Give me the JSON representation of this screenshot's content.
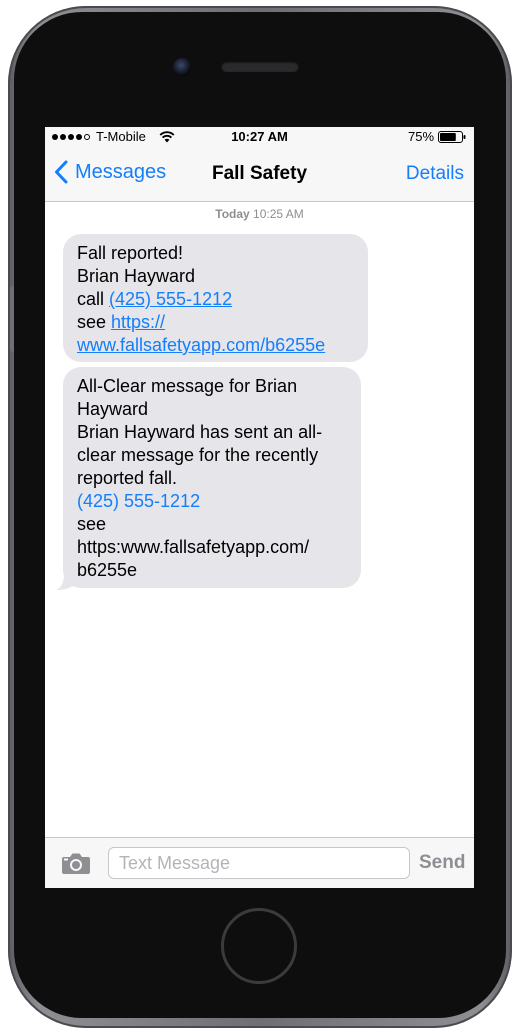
{
  "status_bar": {
    "carrier": "T-Mobile",
    "time": "10:27 AM",
    "battery_percent": "75%",
    "signal_bars": 4,
    "battery_level": 0.75
  },
  "nav": {
    "back_label": "Messages",
    "title": "Fall Safety",
    "details_label": "Details"
  },
  "thread": {
    "timestamp_day": "Today",
    "timestamp_time": "10:25 AM",
    "messages": [
      {
        "line1": "Fall reported!",
        "line2": "Brian Hayward",
        "call_prefix": "call ",
        "phone": "(425) 555-1212",
        "see_prefix": "see ",
        "url_part1": "https://",
        "url_part2": "www.fallsafetyapp.com/b6255e"
      },
      {
        "line1": "All-Clear message for Brian",
        "line2": "Hayward",
        "line3": "Brian Hayward has sent an all-",
        "line4": "clear message for the recently",
        "line5": "reported fall.",
        "phone": "(425) 555-1212",
        "see": "see",
        "url_part1": "https:www.fallsafetyapp.com/",
        "url_part2": "b6255e"
      }
    ]
  },
  "input_bar": {
    "placeholder": "Text Message",
    "value": "",
    "send_label": "Send"
  },
  "colors": {
    "accent": "#147efb",
    "bubble": "#e5e5ea",
    "bar_background": "#f7f7f8"
  },
  "icons": {
    "back": "chevron-left-icon",
    "camera": "camera-icon",
    "wifi": "wifi-icon",
    "battery": "battery-icon"
  }
}
